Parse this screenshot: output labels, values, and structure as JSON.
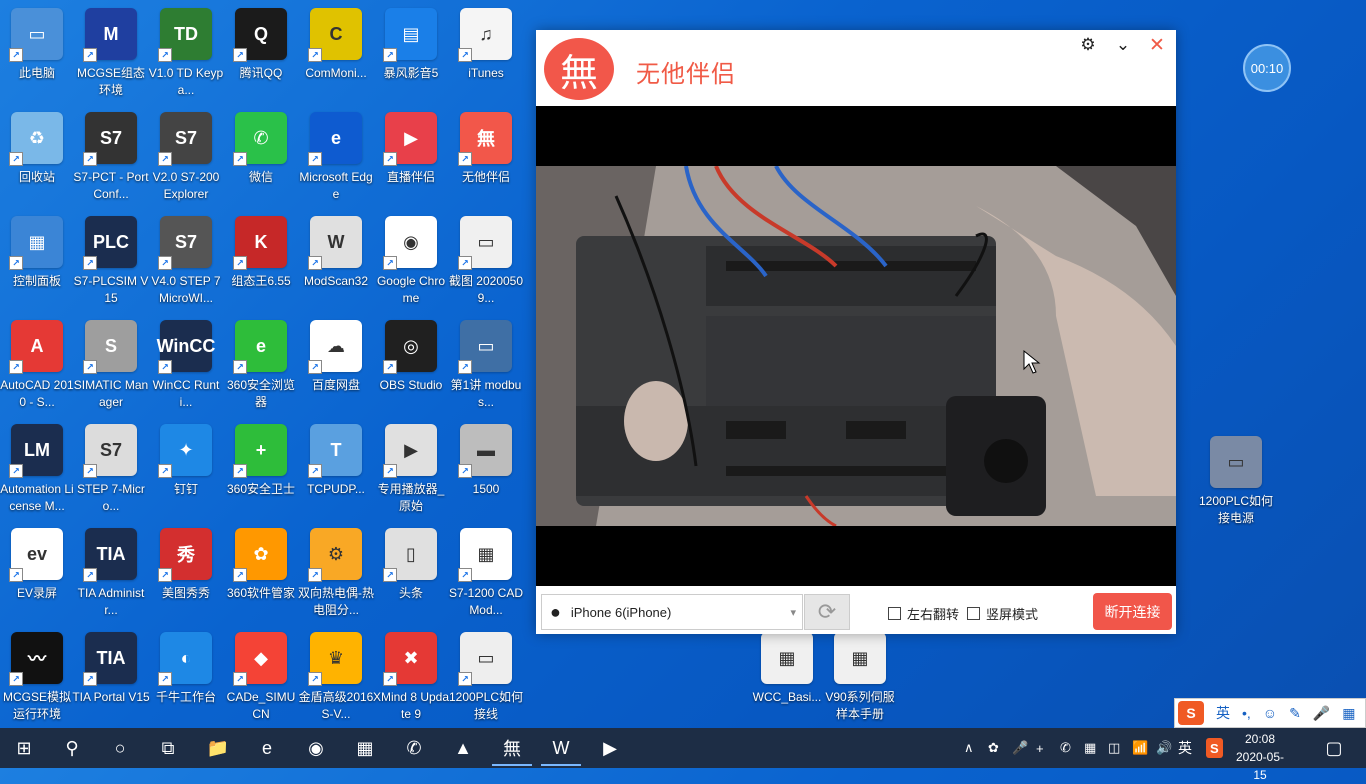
{
  "desktop_icons": [
    {
      "label": "此电脑",
      "color": "#4a90d9",
      "glyph": "▭"
    },
    {
      "label": "MCGSE组态环境",
      "color": "#1f3fa0",
      "glyph": "M"
    },
    {
      "label": "V1.0 TD Keypa...",
      "color": "#2e7d32",
      "glyph": "TD"
    },
    {
      "label": "腾讯QQ",
      "color": "#1b1b1b",
      "glyph": "Q"
    },
    {
      "label": "ComMoni...",
      "color": "#e0c200",
      "glyph": "C"
    },
    {
      "label": "暴风影音5",
      "color": "#1a7fe8",
      "glyph": "▤"
    },
    {
      "label": "iTunes",
      "color": "#f5f5f5",
      "glyph": "♫"
    },
    {
      "label": "回收站",
      "color": "#7ab8e8",
      "glyph": "♻"
    },
    {
      "label": "S7-PCT - Port Conf...",
      "color": "#333",
      "glyph": "S7"
    },
    {
      "label": "V2.0 S7-200 Explorer",
      "color": "#444",
      "glyph": "S7"
    },
    {
      "label": "微信",
      "color": "#2ac149",
      "glyph": "✆"
    },
    {
      "label": "Microsoft Edge",
      "color": "#0e5bd0",
      "glyph": "e"
    },
    {
      "label": "直播伴侣",
      "color": "#e8404a",
      "glyph": "▶"
    },
    {
      "label": "无他伴侣",
      "color": "#f2574a",
      "glyph": "無"
    },
    {
      "label": "控制面板",
      "color": "#3b85d6",
      "glyph": "▦"
    },
    {
      "label": "S7-PLCSIM V15",
      "color": "#1b2d4f",
      "glyph": "PLC"
    },
    {
      "label": "V4.0 STEP 7 MicroWI...",
      "color": "#555",
      "glyph": "S7"
    },
    {
      "label": "组态王6.55",
      "color": "#c62828",
      "glyph": "K"
    },
    {
      "label": "ModScan32",
      "color": "#e0e0e0",
      "glyph": "W"
    },
    {
      "label": "Google Chrome",
      "color": "#ffffff",
      "glyph": "◉"
    },
    {
      "label": "截图 20200509...",
      "color": "#f0f0f0",
      "glyph": "▭"
    },
    {
      "label": "AutoCAD 2010 - S...",
      "color": "#e53935",
      "glyph": "A"
    },
    {
      "label": "SIMATIC Manager",
      "color": "#9e9e9e",
      "glyph": "S"
    },
    {
      "label": "WinCC Runti...",
      "color": "#1b2d4f",
      "glyph": "WinCC"
    },
    {
      "label": "360安全浏览器",
      "color": "#2ebd3a",
      "glyph": "e"
    },
    {
      "label": "百度网盘",
      "color": "#ffffff",
      "glyph": "☁"
    },
    {
      "label": "OBS Studio",
      "color": "#202020",
      "glyph": "◎"
    },
    {
      "label": "第1讲 modbus...",
      "color": "#3f6fa5",
      "glyph": "▭"
    },
    {
      "label": "Automation License M...",
      "color": "#1b2d4f",
      "glyph": "LM"
    },
    {
      "label": "STEP 7-Micro...",
      "color": "#dcdcdc",
      "glyph": "S7"
    },
    {
      "label": "钉钉",
      "color": "#1e88e5",
      "glyph": "✦"
    },
    {
      "label": "360安全卫士",
      "color": "#2ebd3a",
      "glyph": "+"
    },
    {
      "label": "TCPUDP...",
      "color": "#5aa0e0",
      "glyph": "T"
    },
    {
      "label": "专用播放器_原始",
      "color": "#e0e0e0",
      "glyph": "▶"
    },
    {
      "label": "1500",
      "color": "#bdbdbd",
      "glyph": "▬"
    },
    {
      "label": "EV录屏",
      "color": "#ffffff",
      "glyph": "ev"
    },
    {
      "label": "TIA Administr...",
      "color": "#1b2d4f",
      "glyph": "TIA"
    },
    {
      "label": "美图秀秀",
      "color": "#d32f2f",
      "glyph": "秀"
    },
    {
      "label": "360软件管家",
      "color": "#ff9800",
      "glyph": "✿"
    },
    {
      "label": "双向热电偶-热电阻分...",
      "color": "#f9a825",
      "glyph": "⚙"
    },
    {
      "label": "头条",
      "color": "#e0e0e0",
      "glyph": "▯"
    },
    {
      "label": "S7-1200 CAD Mod...",
      "color": "#ffffff",
      "glyph": "▦"
    },
    {
      "label": "MCGSE模拟运行环境",
      "color": "#111",
      "glyph": "〰"
    },
    {
      "label": "TIA Portal V15",
      "color": "#1b2d4f",
      "glyph": "TIA"
    },
    {
      "label": "千牛工作台",
      "color": "#1e88e5",
      "glyph": "◐"
    },
    {
      "label": "CADe_SIMU CN",
      "color": "#f44336",
      "glyph": "◆"
    },
    {
      "label": "金盾高级2016S-V...",
      "color": "#ffb300",
      "glyph": "♛"
    },
    {
      "label": "XMind 8 Update 9",
      "color": "#e53935",
      "glyph": "✖"
    },
    {
      "label": "1200PLC如何接线",
      "color": "#eeeeee",
      "glyph": "▭"
    }
  ],
  "extra_icons": [
    {
      "label": "WCC_Basi...",
      "color": "#f0f0f0",
      "glyph": "▦"
    },
    {
      "label": "V90系列伺服样本手册",
      "color": "#f0f0f0",
      "glyph": "▦"
    },
    {
      "label": "1200PLC如何接电源",
      "color": "#7a8aa5",
      "glyph": "▭"
    }
  ],
  "window": {
    "title": "无他伴侣",
    "logo_glyph": "無",
    "settings_icon": "⚙",
    "minimize_icon": "⌄",
    "close_icon": "✕",
    "device_name": "iPhone 6(iPhone)",
    "refresh_icon": "⟳",
    "flip_label": "左右翻转",
    "portrait_label": "竖屏模式",
    "disconnect_label": "断开连接"
  },
  "timer": "00:10",
  "ime": {
    "logo": "S",
    "lang": "英",
    "items": [
      "•,",
      "☺",
      "✎",
      "🎤",
      "▦"
    ]
  },
  "taskbar": {
    "start_icon": "⊞",
    "search_icon": "⚲",
    "cortana_icon": "○",
    "taskview_icon": "⧉",
    "apps": [
      "📁",
      "e",
      "◉",
      "▦",
      "✆",
      "▲",
      "無",
      "W",
      "▶"
    ],
    "tray_icons": [
      "∧",
      "✿",
      "🎤",
      "+",
      "✆",
      "▦",
      "◫",
      "📶",
      "🔊"
    ],
    "lang": "英",
    "ime_icon": "S",
    "time": "20:08",
    "date": "2020-05-15",
    "notification_icon": "▢"
  }
}
